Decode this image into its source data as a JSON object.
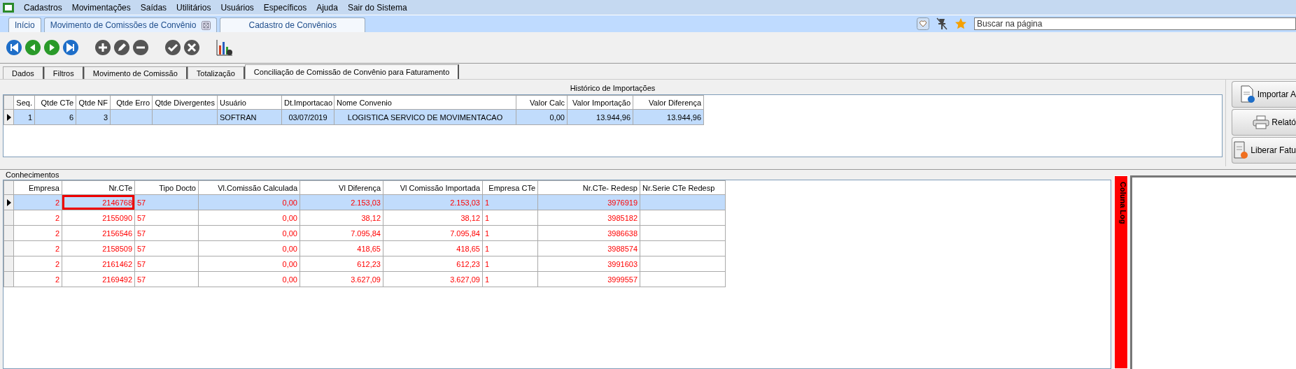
{
  "menu": [
    "Cadastros",
    "Movimentações",
    "Saídas",
    "Utilitários",
    "Usuários",
    "Específicos",
    "Ajuda",
    "Sair do Sistema"
  ],
  "tabs": [
    {
      "label": "Início",
      "selected": false,
      "closable": false
    },
    {
      "label": "Movimento de Comissões de Convênio",
      "selected": true,
      "closable": true
    },
    {
      "label": "Cadastro de Convênios",
      "selected": false,
      "closable": false
    }
  ],
  "search": {
    "placeholder": "Buscar na página"
  },
  "subtabs": [
    {
      "label": "Dados",
      "selected": false
    },
    {
      "label": "Filtros",
      "selected": false
    },
    {
      "label": "Movimento de Comissão",
      "selected": false
    },
    {
      "label": "Totalização",
      "selected": false
    },
    {
      "label": "Conciliação de Comissão de Convênio para Faturamento",
      "selected": true
    }
  ],
  "history": {
    "title": "Histórico de Importações",
    "columns": [
      "Seq.",
      "Qtde CTe",
      "Qtde NF",
      "Qtde Erro",
      "Qtde Divergentes",
      "Usuário",
      "Dt.Importacao",
      "Nome Convenio",
      "Valor Calc",
      "Valor Importação",
      "Valor Diferença"
    ],
    "rows": [
      {
        "selected": true,
        "cells": [
          "1",
          "6",
          "3",
          "",
          "",
          "SOFTRAN",
          "03/07/2019",
          "LOGISTICA SERVICO DE MOVIMENTACAO",
          "0,00",
          "13.944,96",
          "13.944,96"
        ]
      }
    ]
  },
  "side_buttons": [
    {
      "label": "Importar A",
      "kind": "import"
    },
    {
      "label": "Relató",
      "kind": "print"
    },
    {
      "label": "Liberar Fatu",
      "kind": "release"
    }
  ],
  "conhecimentos": {
    "title": "Conhecimentos",
    "columns": [
      "Empresa",
      "Nr.CTe",
      "Tipo Docto",
      "Vl.Comissão Calculada",
      "Vl Diferença",
      "Vl Comissão Importada",
      "Empresa CTe",
      "Nr.CTe- Redesp",
      "Nr.Serie CTe Redesp"
    ],
    "rows": [
      {
        "selected": true,
        "marked": true,
        "cells": [
          "2",
          "2146768",
          "57",
          "0,00",
          "2.153,03",
          "2.153,03",
          "1",
          "3976919",
          ""
        ]
      },
      {
        "selected": false,
        "marked": false,
        "cells": [
          "2",
          "2155090",
          "57",
          "0,00",
          "38,12",
          "38,12",
          "1",
          "3985182",
          ""
        ]
      },
      {
        "selected": false,
        "marked": false,
        "cells": [
          "2",
          "2156546",
          "57",
          "0,00",
          "7.095,84",
          "7.095,84",
          "1",
          "3986638",
          ""
        ]
      },
      {
        "selected": false,
        "marked": false,
        "cells": [
          "2",
          "2158509",
          "57",
          "0,00",
          "418,65",
          "418,65",
          "1",
          "3988574",
          ""
        ]
      },
      {
        "selected": false,
        "marked": false,
        "cells": [
          "2",
          "2161462",
          "57",
          "0,00",
          "612,23",
          "612,23",
          "1",
          "3991603",
          ""
        ]
      },
      {
        "selected": false,
        "marked": false,
        "cells": [
          "2",
          "2169492",
          "57",
          "0,00",
          "3.627,09",
          "3.627,09",
          "1",
          "3999557",
          ""
        ]
      }
    ]
  },
  "log": {
    "label": "Coluna Log"
  }
}
